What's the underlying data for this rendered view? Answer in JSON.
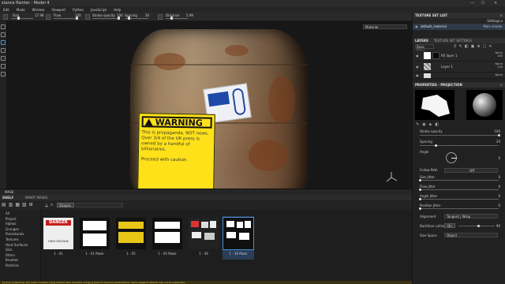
{
  "window": {
    "title": "stance Painter - Model 4",
    "controls": [
      "—",
      "☐",
      "✕"
    ]
  },
  "menu": [
    "Edit",
    "Mode",
    "Window",
    "Viewport",
    "Python",
    "JavaScript",
    "Help"
  ],
  "toolbar": {
    "size_label": "Size",
    "size_value": "17.98",
    "flow_label": "Flow",
    "flow_value": "100",
    "stroke_opacity_label": "Stroke opacity",
    "stroke_opacity_value": "100",
    "spacing_label": "Spacing",
    "spacing_value": "20",
    "lazy_label": "Distance",
    "lazy_value": "5.99"
  },
  "viewport": {
    "mode_dropdown": "Material"
  },
  "model": {
    "warning_heading": "WARNING",
    "warning_lines": [
      "This is propaganda, NOT news.",
      "Over 3/4 of the UK press is",
      "owned by a handful of",
      "billionaires.",
      "Proceed with caution."
    ]
  },
  "right_panel": {
    "texture_set_list_title": "TEXTURE SET LIST",
    "settings_dropdown": "Settings ▾",
    "texture_set_name": "default_material",
    "texture_set_shader": "Main shader",
    "layers_tab": "LAYERS",
    "texture_set_settings_tab": "TEXTURE SET SETTINGS",
    "base_color_dropdown": "Base Color",
    "layers": [
      {
        "name": "Fill layer 1",
        "blend": "Norm",
        "opacity": "100"
      },
      {
        "name": "Layer 1",
        "blend": "Norm",
        "opacity": "100"
      },
      {
        "name": "",
        "blend": "Norm",
        "opacity": ""
      }
    ],
    "properties_title": "PROPERTIES - PROJECTION",
    "props": [
      {
        "label": "Stroke opacity",
        "value": "100",
        "fill": 1.0
      },
      {
        "label": "Spacing",
        "value": "20",
        "fill": 0.2
      },
      {
        "label": "Angle",
        "value": "0"
      }
    ],
    "follow_path_label": "Follow Path",
    "follow_path_value": "Off",
    "jitters": [
      {
        "label": "Size Jitter",
        "value": "0"
      },
      {
        "label": "Flow Jitter",
        "value": "0"
      },
      {
        "label": "Angle Jitter",
        "value": "0"
      },
      {
        "label": "Position Jitter",
        "value": "0"
      }
    ],
    "alignment_label": "Alignment",
    "alignment_value": "Tangent | Wrap",
    "backface_label": "Backface culling",
    "backface_value": "On",
    "backface_number": "90",
    "size_space_label": "Size Space",
    "size_space_value": "Object"
  },
  "mask_tab": "MASK",
  "shelf": {
    "tabs": [
      "SHELF",
      "SMART MASKS"
    ],
    "search_chip": "Shapes",
    "categories": [
      "All",
      "Project",
      "Alphas",
      "Grunges",
      "Procedurals",
      "Textures",
      "Hard Surfaces",
      "Skin",
      "Filters",
      "Brushes",
      "Particles"
    ],
    "items": [
      {
        "label": "1 - 01",
        "kind": "danger"
      },
      {
        "label": "1 - 01 Mask",
        "kind": "mask"
      },
      {
        "label": "1 - 05",
        "kind": "warning"
      },
      {
        "label": "1 - 05 Mask",
        "kind": "mask2"
      },
      {
        "label": "1 - 36",
        "kind": "stickers"
      },
      {
        "label": "1 - 36 Mask",
        "kind": "mask3"
      }
    ],
    "danger_text": "DANGER",
    "danger_sub": "HIGH VOLTAGE"
  },
  "status_text": "[Scene 1] Warning: The mesh contains many texture sets. Consider merging them to improve performance. Some viewport effects may not be supported."
}
